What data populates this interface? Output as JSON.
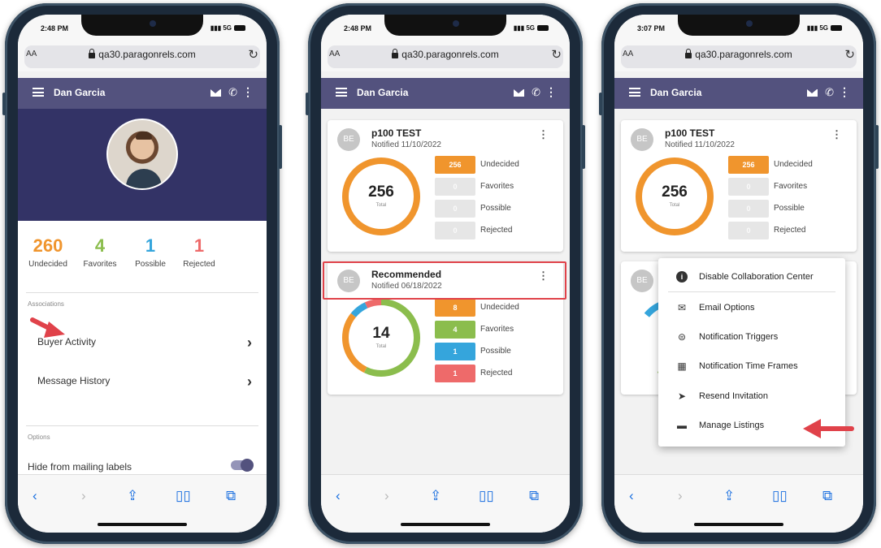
{
  "phones": [
    {
      "status": {
        "time": "2:48 PM",
        "signal": "5G"
      },
      "browser": {
        "aa": "AA",
        "url": "qa30.paragonrels.com"
      },
      "appbar": {
        "name": "Dan Garcia"
      },
      "counts": [
        {
          "value": "260",
          "label": "Undecided",
          "color": "#f0952d"
        },
        {
          "value": "4",
          "label": "Favorites",
          "color": "#8bbd4d"
        },
        {
          "value": "1",
          "label": "Possible",
          "color": "#35a5dc"
        },
        {
          "value": "1",
          "label": "Rejected",
          "color": "#ee6a6a"
        }
      ],
      "associations": {
        "header": "Associations",
        "items": [
          "Buyer Activity",
          "Message History"
        ]
      },
      "options": {
        "header": "Options",
        "toggle_label": "Hide from mailing labels",
        "toggle_on": true
      }
    },
    {
      "status": {
        "time": "2:48 PM",
        "signal": "5G"
      },
      "browser": {
        "aa": "AA",
        "url": "qa30.paragonrels.com"
      },
      "appbar": {
        "name": "Dan Garcia"
      },
      "cards": [
        {
          "initials": "BE",
          "title": "p100 TEST",
          "subtitle": "Notified 11/10/2022",
          "total": "256",
          "total_label": "Total",
          "rows": [
            {
              "value": "256",
              "label": "Undecided",
              "color": "#f0952d"
            },
            {
              "value": "0",
              "label": "Favorites",
              "color": "#e6e6e6"
            },
            {
              "value": "0",
              "label": "Possible",
              "color": "#e6e6e6"
            },
            {
              "value": "0",
              "label": "Rejected",
              "color": "#e6e6e6"
            }
          ]
        },
        {
          "initials": "BE",
          "title": "Recommended",
          "subtitle": "Notified 06/18/2022",
          "total": "14",
          "total_label": "Total",
          "rows": [
            {
              "value": "8",
              "label": "Undecided",
              "color": "#f0952d"
            },
            {
              "value": "4",
              "label": "Favorites",
              "color": "#8bbd4d"
            },
            {
              "value": "1",
              "label": "Possible",
              "color": "#35a5dc"
            },
            {
              "value": "1",
              "label": "Rejected",
              "color": "#ee6a6a"
            }
          ]
        }
      ]
    },
    {
      "status": {
        "time": "3:07 PM",
        "signal": "5G"
      },
      "browser": {
        "aa": "AA",
        "url": "qa30.paragonrels.com"
      },
      "appbar": {
        "name": "Dan Garcia"
      },
      "card": {
        "initials": "BE",
        "title": "p100 TEST",
        "subtitle": "Notified 11/10/2022",
        "total": "256",
        "total_label": "Total",
        "rows": [
          {
            "value": "256",
            "label": "Undecided",
            "color": "#f0952d"
          },
          {
            "value": "0",
            "label": "Favorites",
            "color": "#e6e6e6"
          },
          {
            "value": "0",
            "label": "Possible",
            "color": "#e6e6e6"
          },
          {
            "value": "0",
            "label": "Rejected",
            "color": "#e6e6e6"
          }
        ],
        "second_initials": "BE"
      },
      "menu": [
        {
          "icon": "info-icon",
          "label": "Disable Collaboration Center"
        },
        {
          "icon": "envelope-icon",
          "label": "Email Options"
        },
        {
          "icon": "toggle-icon",
          "label": "Notification Triggers"
        },
        {
          "icon": "calendar-clock-icon",
          "label": "Notification Time Frames"
        },
        {
          "icon": "send-icon",
          "label": "Resend Invitation"
        },
        {
          "icon": "listings-icon",
          "label": "Manage Listings"
        }
      ]
    }
  ],
  "colors": {
    "appbar": "#53527e",
    "hero": "#333366",
    "highlight": "#e0424a",
    "link_blue": "#1a6fe0"
  }
}
